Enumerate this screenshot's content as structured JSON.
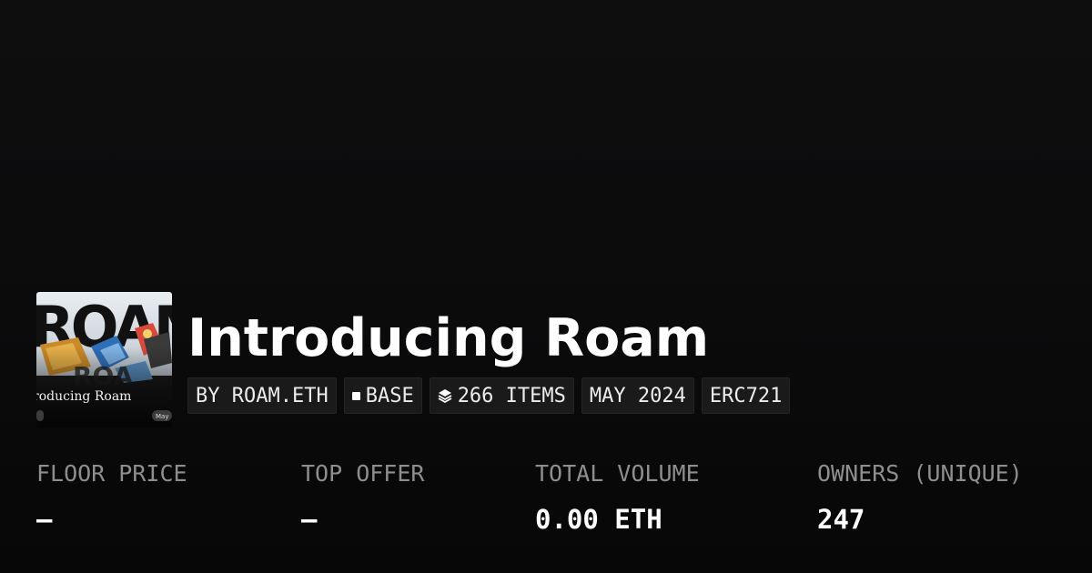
{
  "collection": {
    "title": "Introducing Roam",
    "thumbnail": {
      "alt_text": "ROAM",
      "caption": "roducing Roam",
      "badge": "May"
    },
    "tags": [
      {
        "label": "BY ROAM.ETH",
        "icon": null
      },
      {
        "label": "BASE",
        "icon": "square-icon"
      },
      {
        "label": "266 ITEMS",
        "icon": "layers-icon"
      },
      {
        "label": "MAY 2024",
        "icon": null
      },
      {
        "label": "ERC721",
        "icon": null
      }
    ]
  },
  "stats": [
    {
      "label": "FLOOR PRICE",
      "value": "–"
    },
    {
      "label": "TOP OFFER",
      "value": "–"
    },
    {
      "label": "TOTAL VOLUME",
      "value": "0.00 ETH"
    },
    {
      "label": "OWNERS (UNIQUE)",
      "value": "247"
    }
  ],
  "colors": {
    "background": "#0b0b0c",
    "tag_background": "#1a1a1b",
    "label": "#8e8e8e",
    "text": "#ffffff"
  }
}
